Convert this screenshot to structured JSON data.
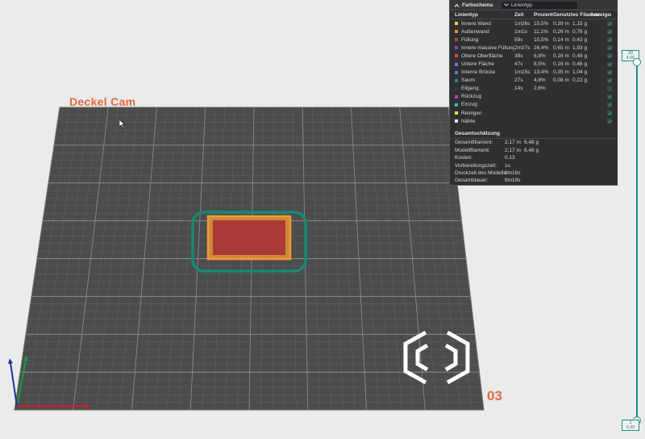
{
  "plate": {
    "name": "Deckel Cam",
    "number": "03"
  },
  "legend": {
    "title": "Farbschema",
    "view_mode": "Linientyp",
    "columns": {
      "type": "Linientyp",
      "time": "Zeit",
      "percent": "Prozent",
      "used": "Genutztes Filament",
      "show": "Anzeigen"
    },
    "rows": [
      {
        "label": "Innere Wand",
        "color": "#f3d33a",
        "time": "1m26s",
        "percent": "15,5%",
        "meters": "0,39 m",
        "grams": "1,15 g",
        "visible": true
      },
      {
        "label": "Außenwand",
        "color": "#f28b2b",
        "time": "1m1s",
        "percent": "11,1%",
        "meters": "0,26 m",
        "grams": "0,76 g",
        "visible": true
      },
      {
        "label": "Füllung",
        "color": "#b3483a",
        "time": "59s",
        "percent": "10,5%",
        "meters": "0,14 m",
        "grams": "0,43 g",
        "visible": true
      },
      {
        "label": "Innere massive Füllung",
        "color": "#9a3fa8",
        "time": "2m27s",
        "percent": "26,4%",
        "meters": "0,65 m",
        "grams": "1,93 g",
        "visible": true
      },
      {
        "label": "Obere Oberfläche",
        "color": "#e04a4a",
        "time": "38s",
        "percent": "6,8%",
        "meters": "0,16 m",
        "grams": "0,48 g",
        "visible": true
      },
      {
        "label": "Untere Fläche",
        "color": "#8f6cd6",
        "time": "47s",
        "percent": "8,5%",
        "meters": "0,16 m",
        "grams": "0,46 g",
        "visible": true
      },
      {
        "label": "Interne Brücke",
        "color": "#4f7fd6",
        "time": "1m15s",
        "percent": "13,4%",
        "meters": "0,35 m",
        "grams": "1,04 g",
        "visible": true
      },
      {
        "label": "Saum",
        "color": "#1f8f7c",
        "time": "27s",
        "percent": "4,8%",
        "meters": "0,08 m",
        "grams": "0,22 g",
        "visible": true
      },
      {
        "label": "Eilgang",
        "color": "#3b3b3b",
        "time": "14s",
        "percent": "2,6%",
        "meters": "",
        "grams": "",
        "visible": false
      },
      {
        "label": "Rückzug",
        "color": "#c23fb3",
        "time": "",
        "percent": "",
        "meters": "",
        "grams": "",
        "visible": true
      },
      {
        "label": "Einzug",
        "color": "#5aa6d8",
        "time": "",
        "percent": "",
        "meters": "",
        "grams": "",
        "visible": true
      },
      {
        "label": "Reinigen",
        "color": "#f2e23a",
        "time": "",
        "percent": "",
        "meters": "",
        "grams": "",
        "visible": true
      },
      {
        "label": "Nähte",
        "color": "#e6e6e6",
        "time": "",
        "percent": "",
        "meters": "",
        "grams": "",
        "visible": true
      }
    ],
    "estimate_title": "Gesamtschätzung",
    "estimates": [
      {
        "label": "Gesamtfilament:",
        "v1": "2,17 m",
        "v2": "6,48 g"
      },
      {
        "label": "Modellfilament:",
        "v1": "2,17 m",
        "v2": "6,48 g"
      },
      {
        "label": "Kosten:",
        "v1": "0,13",
        "v2": ""
      },
      {
        "label": "Vorbereitungszeit:",
        "v1": "1s",
        "v2": ""
      },
      {
        "label": "Druckzeit des Modells:",
        "v1": "9m18s",
        "v2": ""
      },
      {
        "label": "Gesamtdauer:",
        "v1": "9m19s",
        "v2": ""
      }
    ]
  },
  "layer_slider": {
    "top_layer": "20",
    "top_height": "4,00",
    "bottom_layer": "1",
    "bottom_height": "0,20"
  },
  "colors": {
    "accent": "#1e9080",
    "plate_label": "#e8663a"
  }
}
